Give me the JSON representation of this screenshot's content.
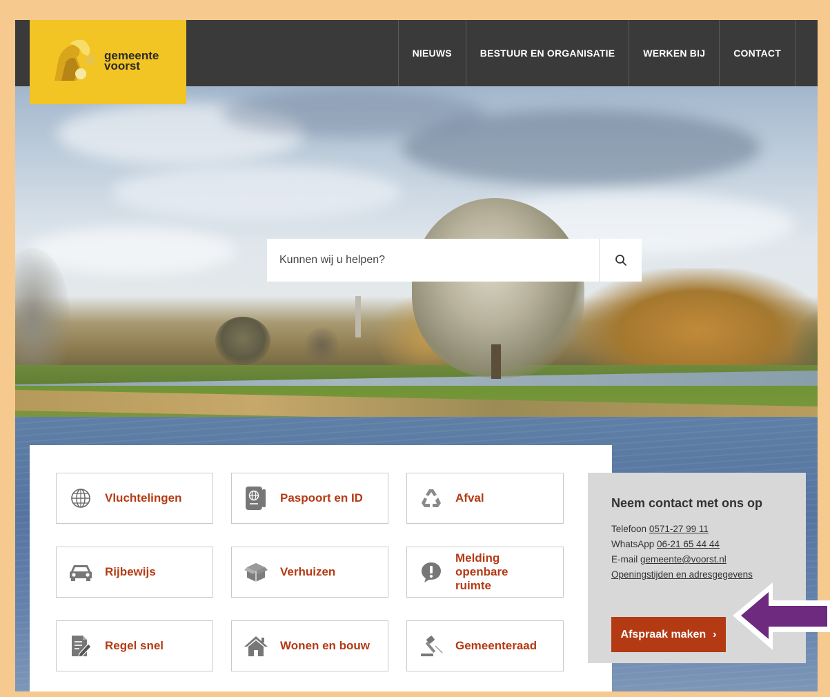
{
  "header": {
    "logo_line1": "gemeente",
    "logo_line2": "voorst",
    "nav": [
      "NIEUWS",
      "BESTUUR EN ORGANISATIE",
      "WERKEN BIJ",
      "CONTACT"
    ]
  },
  "search": {
    "placeholder": "Kunnen wij u helpen?"
  },
  "tiles": [
    {
      "label": "Vluchtelingen",
      "icon": "globe-icon"
    },
    {
      "label": "Paspoort en ID",
      "icon": "passport-icon"
    },
    {
      "label": "Afval",
      "icon": "recycle-icon"
    },
    {
      "label": "Rijbewijs",
      "icon": "car-icon"
    },
    {
      "label": "Verhuizen",
      "icon": "box-icon"
    },
    {
      "label": "Melding openbare ruimte",
      "label_lines": [
        "Melding",
        "openbare",
        "ruimte"
      ],
      "icon": "exclamation-icon"
    },
    {
      "label": "Regel snel",
      "icon": "form-pen-icon"
    },
    {
      "label": "Wonen en bouw",
      "icon": "house-icon"
    },
    {
      "label": "Gemeenteraad",
      "icon": "gavel-icon"
    }
  ],
  "contact": {
    "title": "Neem contact met ons op",
    "phone_label": "Telefoon",
    "phone": "0571-27 99 11",
    "whatsapp_label": "WhatsApp",
    "whatsapp": "06-21 65 44 44",
    "email_label": "E-mail",
    "email": "gemeente@voorst.nl",
    "hours_link": "Openingstijden en adresgegevens",
    "appointment_button": "Afspraak maken",
    "appointment_chevron": "›"
  },
  "colors": {
    "border_frame": "#f6c98f",
    "header_bg": "#3a3a3a",
    "logo_bg": "#f2c525",
    "accent": "#b43a14",
    "contact_bg": "#d8d8d8",
    "annotation_arrow": "#6d2a7f"
  }
}
